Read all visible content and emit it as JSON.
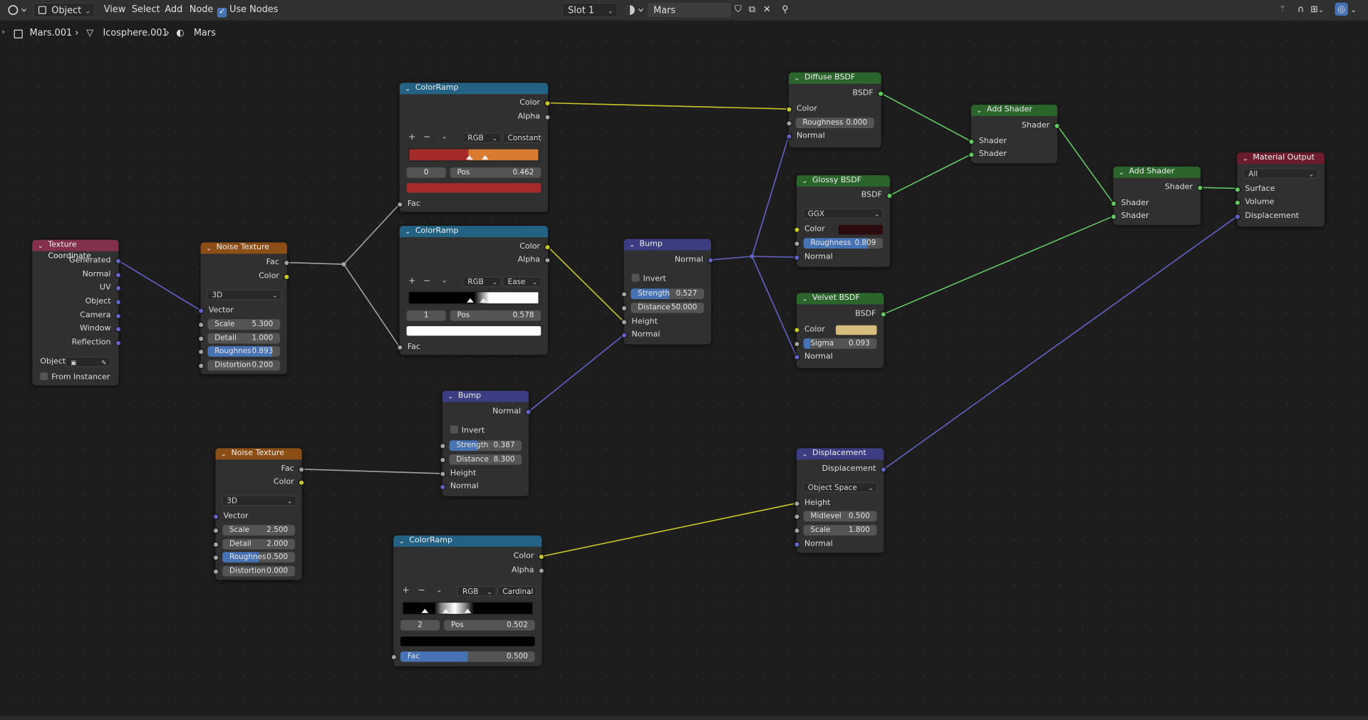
{
  "header": {
    "mode": "Object",
    "menu": [
      "View",
      "Select",
      "Add",
      "Node"
    ],
    "use_nodes_label": "Use Nodes",
    "slot": "Slot 1",
    "material": "Mars"
  },
  "breadcrumb": [
    "Mars.001",
    "Icosphere.001",
    "Mars"
  ],
  "nodes": {
    "tex_coord": {
      "title": "Texture Coordinate",
      "outputs": [
        "Generated",
        "Normal",
        "UV",
        "Object",
        "Camera",
        "Window",
        "Reflection"
      ],
      "object_label": "Object:",
      "from_instancer": "From Instancer"
    },
    "noise1": {
      "title": "Noise Texture",
      "out_fac": "Fac",
      "out_color": "Color",
      "dim": "3D",
      "vector": "Vector",
      "scale_k": "Scale",
      "scale_v": "5.300",
      "detail_k": "Detail",
      "detail_v": "1.000",
      "rough_k": "Roughnes",
      "rough_v": "0.893",
      "dist_k": "Distortion",
      "dist_v": "0.200"
    },
    "noise2": {
      "title": "Noise Texture",
      "out_fac": "Fac",
      "out_color": "Color",
      "dim": "3D",
      "vector": "Vector",
      "scale_k": "Scale",
      "scale_v": "2.500",
      "detail_k": "Detail",
      "detail_v": "2.000",
      "rough_k": "Roughnes",
      "rough_v": "0.500",
      "dist_k": "Distortion",
      "dist_v": "0.000"
    },
    "ramp1": {
      "title": "ColorRamp",
      "out_color": "Color",
      "out_alpha": "Alpha",
      "mode": "RGB",
      "interp": "Constant",
      "index": "0",
      "pos_k": "Pos",
      "pos_v": "0.462",
      "in_fac": "Fac",
      "swatch": "#a52a2a"
    },
    "ramp2": {
      "title": "ColorRamp",
      "out_color": "Color",
      "out_alpha": "Alpha",
      "mode": "RGB",
      "interp": "Ease",
      "index": "1",
      "pos_k": "Pos",
      "pos_v": "0.578",
      "in_fac": "Fac",
      "swatch": "#ffffff"
    },
    "ramp3": {
      "title": "ColorRamp",
      "out_color": "Color",
      "out_alpha": "Alpha",
      "mode": "RGB",
      "interp": "Cardinal",
      "index": "2",
      "pos_k": "Pos",
      "pos_v": "0.502",
      "fac_k": "Fac",
      "fac_v": "0.500",
      "swatch": "#000000"
    },
    "bump1": {
      "title": "Bump",
      "out": "Normal",
      "invert": "Invert",
      "str_k": "Strength",
      "str_v": "0.527",
      "dist_k": "Distance",
      "dist_v": "50.000",
      "height": "Height",
      "normal": "Normal"
    },
    "bump2": {
      "title": "Bump",
      "out": "Normal",
      "invert": "Invert",
      "str_k": "Strength",
      "str_v": "0.387",
      "dist_k": "Distance",
      "dist_v": "8.300",
      "height": "Height",
      "normal": "Normal"
    },
    "diffuse": {
      "title": "Diffuse BSDF",
      "out": "BSDF",
      "color": "Color",
      "rough_k": "Roughness",
      "rough_v": "0.000",
      "normal": "Normal"
    },
    "glossy": {
      "title": "Glossy BSDF",
      "out": "BSDF",
      "dist": "GGX",
      "color": "Color",
      "rough_k": "Roughness",
      "rough_v": "0.809",
      "normal": "Normal",
      "swatch": "#2a0a0c"
    },
    "velvet": {
      "title": "Velvet BSDF",
      "out": "BSDF",
      "color": "Color",
      "sigma_k": "Sigma",
      "sigma_v": "0.093",
      "normal": "Normal",
      "swatch": "#d8bc7c"
    },
    "add1": {
      "title": "Add Shader",
      "out": "Shader",
      "in1": "Shader",
      "in2": "Shader"
    },
    "add2": {
      "title": "Add Shader",
      "out": "Shader",
      "in1": "Shader",
      "in2": "Shader"
    },
    "output": {
      "title": "Material Output",
      "target": "All",
      "surface": "Surface",
      "volume": "Volume",
      "displacement": "Displacement"
    },
    "disp": {
      "title": "Displacement",
      "out": "Displacement",
      "space": "Object Space",
      "height": "Height",
      "mid_k": "Midlevel",
      "mid_v": "0.500",
      "scale_k": "Scale",
      "scale_v": "1.800",
      "normal": "Normal"
    }
  },
  "colors": {
    "converter": "#246283",
    "texture": "#8a4e16",
    "input": "#83314a",
    "vector": "#3c3c83",
    "shader": "#2b652b",
    "output": "#6b1d2e",
    "accent": "#4772b3"
  }
}
